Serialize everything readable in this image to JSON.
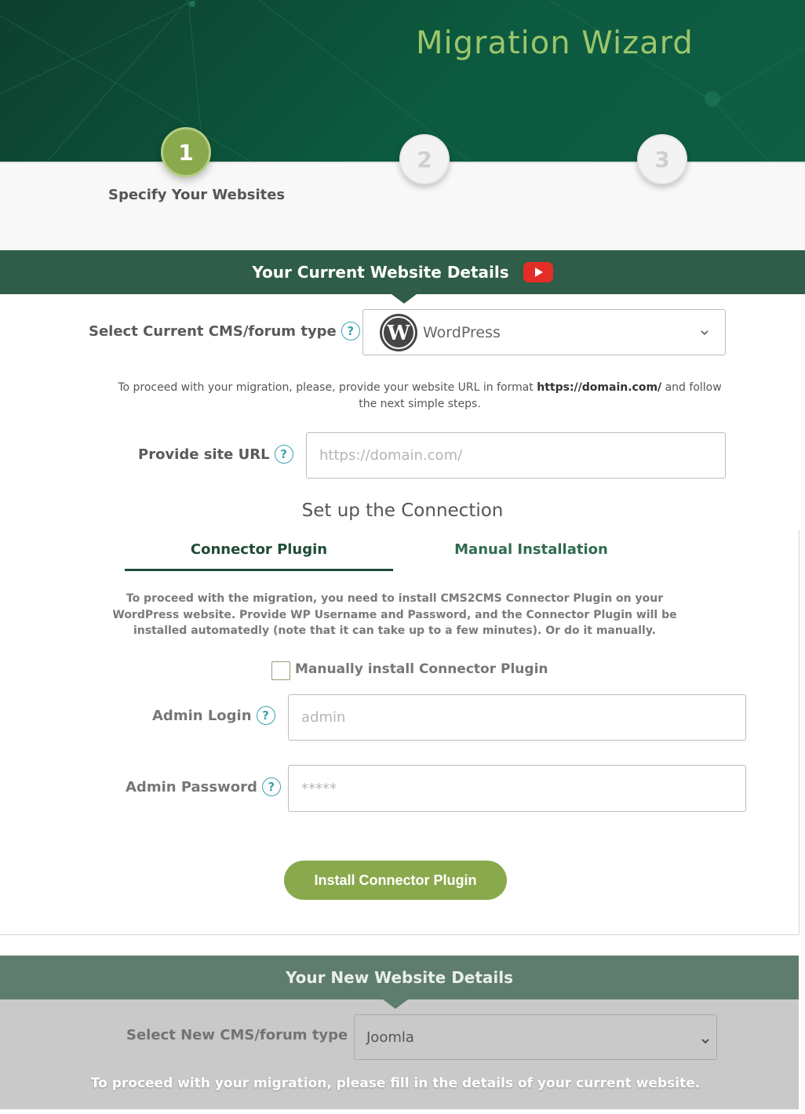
{
  "header": {
    "title": "Migration Wizard"
  },
  "steps": [
    {
      "number": "1",
      "label": "Specify Your Websites",
      "state": "active"
    },
    {
      "number": "2",
      "state": "inactive"
    },
    {
      "number": "3",
      "state": "inactive"
    }
  ],
  "current_site": {
    "section_title": "Your Current Website Details",
    "cms_label": "Select Current CMS/forum type",
    "cms_selected": "WordPress",
    "cms_icon": "wordpress-logo-icon",
    "info_text_before": "To proceed with your migration, please, provide your website URL in format ",
    "info_text_url": "https://domain.com/",
    "info_text_after": " and follow the next simple steps.",
    "url_label": "Provide site URL",
    "url_placeholder": "https://domain.com/",
    "help_glyph": "?"
  },
  "connection": {
    "title": "Set up the Connection",
    "tabs": [
      {
        "label": "Connector Plugin",
        "active": true
      },
      {
        "label": "Manual Installation",
        "active": false
      }
    ],
    "description": "To proceed with the migration, you need to install CMS2CMS Connector Plugin on your WordPress website. Provide WP Username and Password, and the Connector Plugin will be installed automatedly (note that it can take up to a few minutes). Or do it manually.",
    "manual_checkbox_label": "Manually install Connector Plugin",
    "manual_checkbox_checked": false,
    "login_label": "Admin Login",
    "login_placeholder": "admin",
    "password_label": "Admin Password",
    "password_placeholder": "*****",
    "install_button": "Install Connector Plugin"
  },
  "new_site": {
    "section_title": "Your New Website Details",
    "cms_label": "Select New CMS/forum type",
    "cms_selected": "Joomla",
    "info_text": "To proceed with your migration, please fill in the details of your current website."
  },
  "colors": {
    "brand_green": "#8aa94c",
    "header_dark": "#2f5d49",
    "title_green": "#9cc56b",
    "help_teal": "#3aa3ad",
    "youtube_red": "#e52d27"
  }
}
